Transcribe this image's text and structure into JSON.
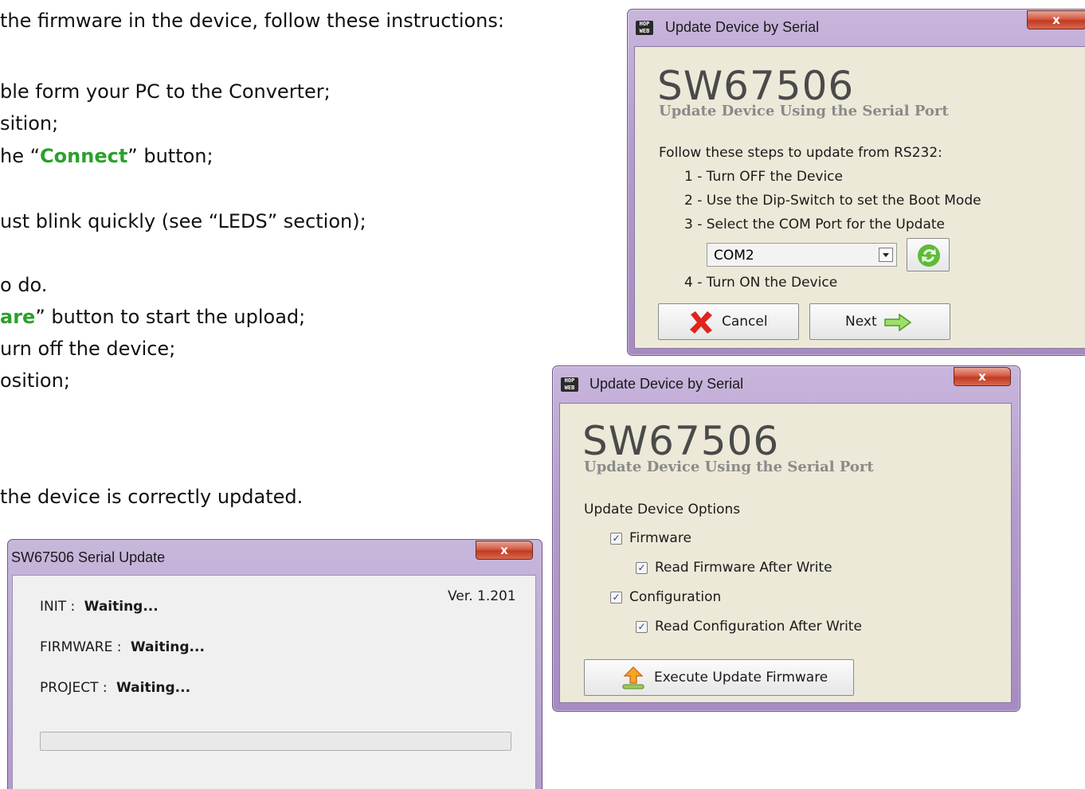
{
  "document": {
    "lines": [
      {
        "pre": "the firmware in the device, follow these instructions:",
        "hl": "",
        "post": ""
      },
      {
        "pre": "ble form your PC to the Converter;",
        "hl": "",
        "post": ""
      },
      {
        "pre": "sition;",
        "hl": "",
        "post": ""
      },
      {
        "pre": "he “",
        "hl": "Connect",
        "post": "” button;"
      },
      {
        "pre": "ust blink quickly (see “LEDS” section);",
        "hl": "",
        "post": ""
      },
      {
        "pre": "o do.",
        "hl": "",
        "post": ""
      },
      {
        "pre": "",
        "hl": "are",
        "post": "” button to start the upload;"
      },
      {
        "pre": "urn off the device;",
        "hl": "",
        "post": ""
      },
      {
        "pre": "osition;",
        "hl": "",
        "post": ""
      },
      {
        "pre": " the device is correctly updated.",
        "hl": "",
        "post": ""
      }
    ],
    "highlight_color": "#2ca02c"
  },
  "window1": {
    "title": "Update Device by Serial",
    "icon_text": "HOP WEB",
    "close_glyph": "x",
    "product": "SW67506",
    "subtitle": "Update Device Using the Serial Port",
    "intro": "Follow these steps to update from RS232:",
    "steps": [
      "1 - Turn OFF the Device",
      "2 - Use the Dip-Switch to set the Boot Mode",
      "3 - Select the COM Port for the Update",
      "4 - Turn ON the Device"
    ],
    "com_port": "COM2",
    "cancel_label": "Cancel",
    "next_label": "Next"
  },
  "window2": {
    "title": "Update Device by Serial",
    "icon_text": "HOP WEB",
    "close_glyph": "x",
    "product": "SW67506",
    "subtitle": "Update Device Using the Serial Port",
    "options_heading": "Update Device Options",
    "options": [
      {
        "label": "Firmware",
        "checked": true
      },
      {
        "label": "Read Firmware After Write",
        "checked": true
      },
      {
        "label": "Configuration",
        "checked": true
      },
      {
        "label": "Read Configuration After Write",
        "checked": true
      }
    ],
    "execute_label": "Execute Update Firmware"
  },
  "window3": {
    "title": "SW67506 Serial Update",
    "close_glyph": "x",
    "version": "Ver. 1.201",
    "rows": [
      {
        "label": "INIT :",
        "value": "Waiting..."
      },
      {
        "label": "FIRMWARE :",
        "value": "Waiting..."
      },
      {
        "label": "PROJECT :",
        "value": "Waiting..."
      }
    ],
    "progress": 0
  },
  "colors": {
    "window_frame": "#b49ccd",
    "client_bg": "#ece9d8",
    "close_red": "#c23a22"
  }
}
